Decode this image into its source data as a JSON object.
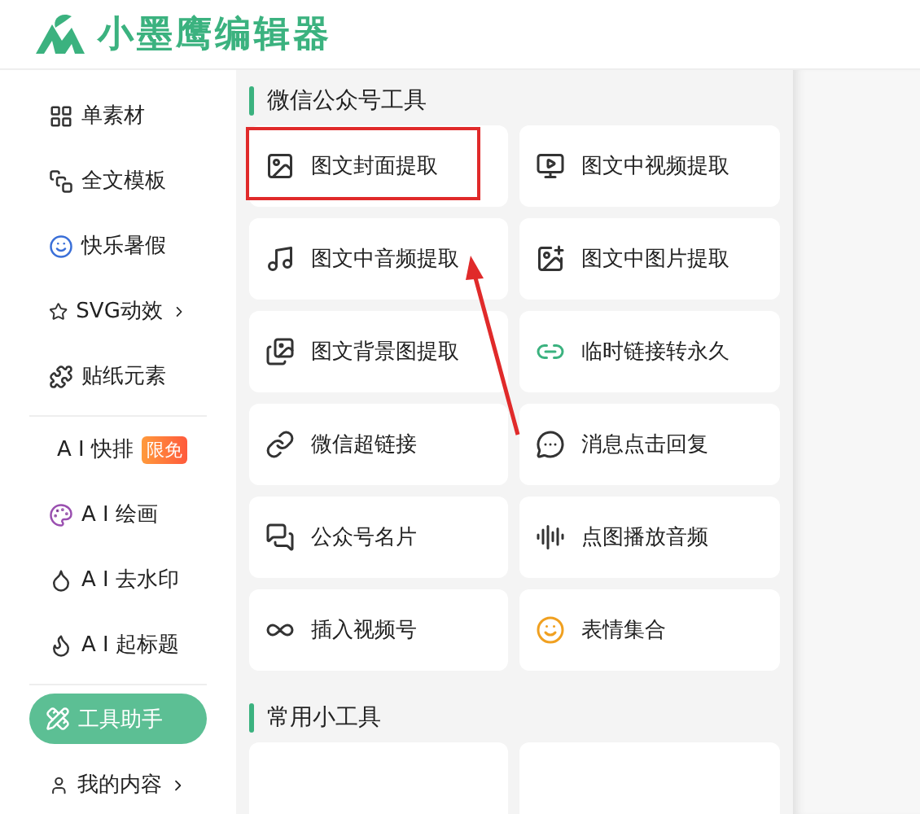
{
  "header": {
    "logo_text": "小墨鹰编辑器"
  },
  "sidebar": {
    "groups": [
      {
        "items": [
          {
            "label": "单素材",
            "selected": false
          },
          {
            "label": "全文模板",
            "selected": false
          },
          {
            "label": "快乐暑假",
            "selected": false
          },
          {
            "label": "SVG动效",
            "selected": false,
            "has_submenu": true
          },
          {
            "label": "贴纸元素",
            "selected": false
          }
        ]
      },
      {
        "items": [
          {
            "label": "A I 快排",
            "selected": false,
            "badge": "限免"
          },
          {
            "label": "A I 绘画",
            "selected": false
          },
          {
            "label": "A I 去水印",
            "selected": false
          },
          {
            "label": "A I 起标题",
            "selected": false
          }
        ]
      },
      {
        "items": [
          {
            "label": "工具助手",
            "selected": true
          },
          {
            "label": "我的内容",
            "selected": false,
            "has_submenu": true
          }
        ]
      }
    ]
  },
  "sections": [
    {
      "title": "微信公众号工具",
      "tools": [
        {
          "label": "图文封面提取",
          "highlighted": true
        },
        {
          "label": "图文中视频提取",
          "highlighted": false
        },
        {
          "label": "图文中音频提取",
          "highlighted": false
        },
        {
          "label": "图文中图片提取",
          "highlighted": false
        },
        {
          "label": "图文背景图提取",
          "highlighted": false
        },
        {
          "label": "临时链接转永久",
          "highlighted": false
        },
        {
          "label": "微信超链接",
          "highlighted": false
        },
        {
          "label": "消息点击回复",
          "highlighted": false
        },
        {
          "label": "公众号名片",
          "highlighted": false
        },
        {
          "label": "点图播放音频",
          "highlighted": false
        },
        {
          "label": "插入视频号",
          "highlighted": false
        },
        {
          "label": "表情集合",
          "highlighted": false
        }
      ]
    },
    {
      "title": "常用小工具"
    }
  ]
}
